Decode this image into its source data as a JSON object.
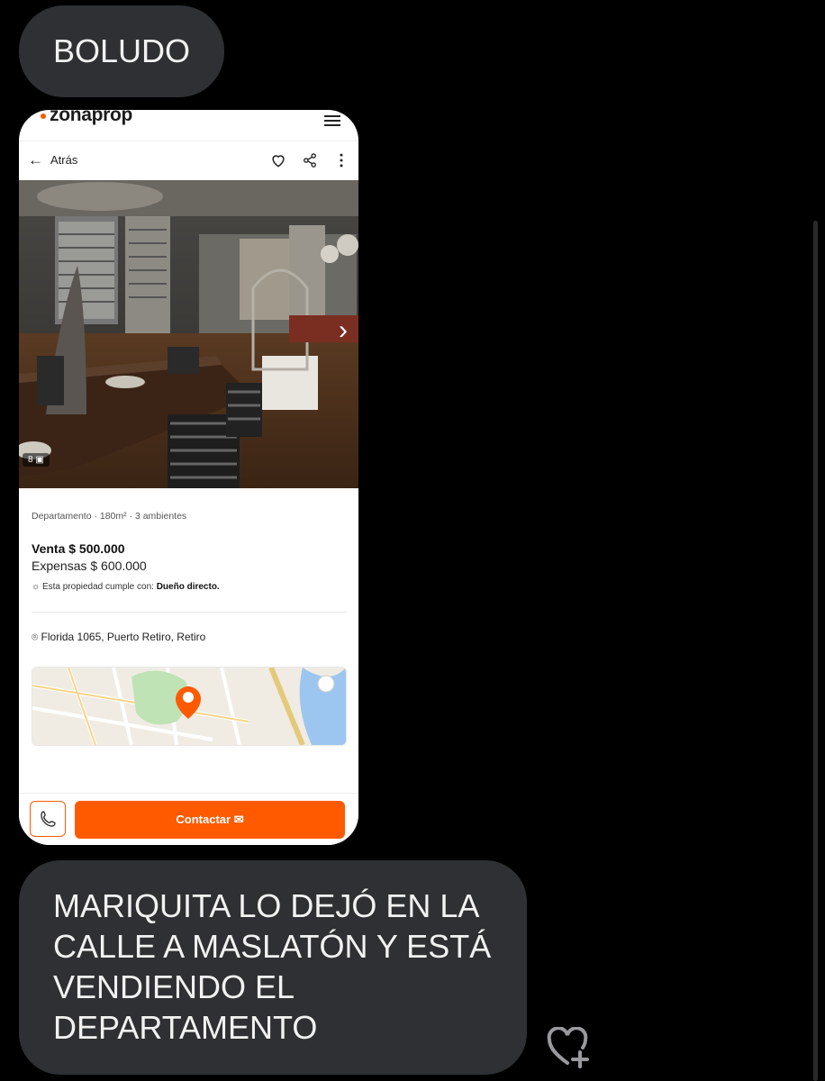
{
  "messages": [
    {
      "text": "BOLUDO"
    },
    {
      "text": "MARIQUITA LO DEJÓ EN LA CALLE A MASLATÓN Y ESTÁ VENDIENDO EL DEPARTAMENTO"
    }
  ],
  "listing": {
    "logo": "zonaprop",
    "back_label": "Atrás",
    "photo_count": "8",
    "meta": "Departamento · 180m² · 3 ambientes",
    "price": "Venta $ 500.000",
    "expenses": "Expensas $ 600.000",
    "feature_prefix": "Esta propiedad cumple con: ",
    "feature_value": "Dueño directo.",
    "address": "Florida 1065, Puerto Retiro, Retiro",
    "contact_label": "Contactar",
    "brand_color": "#ff5a00"
  }
}
